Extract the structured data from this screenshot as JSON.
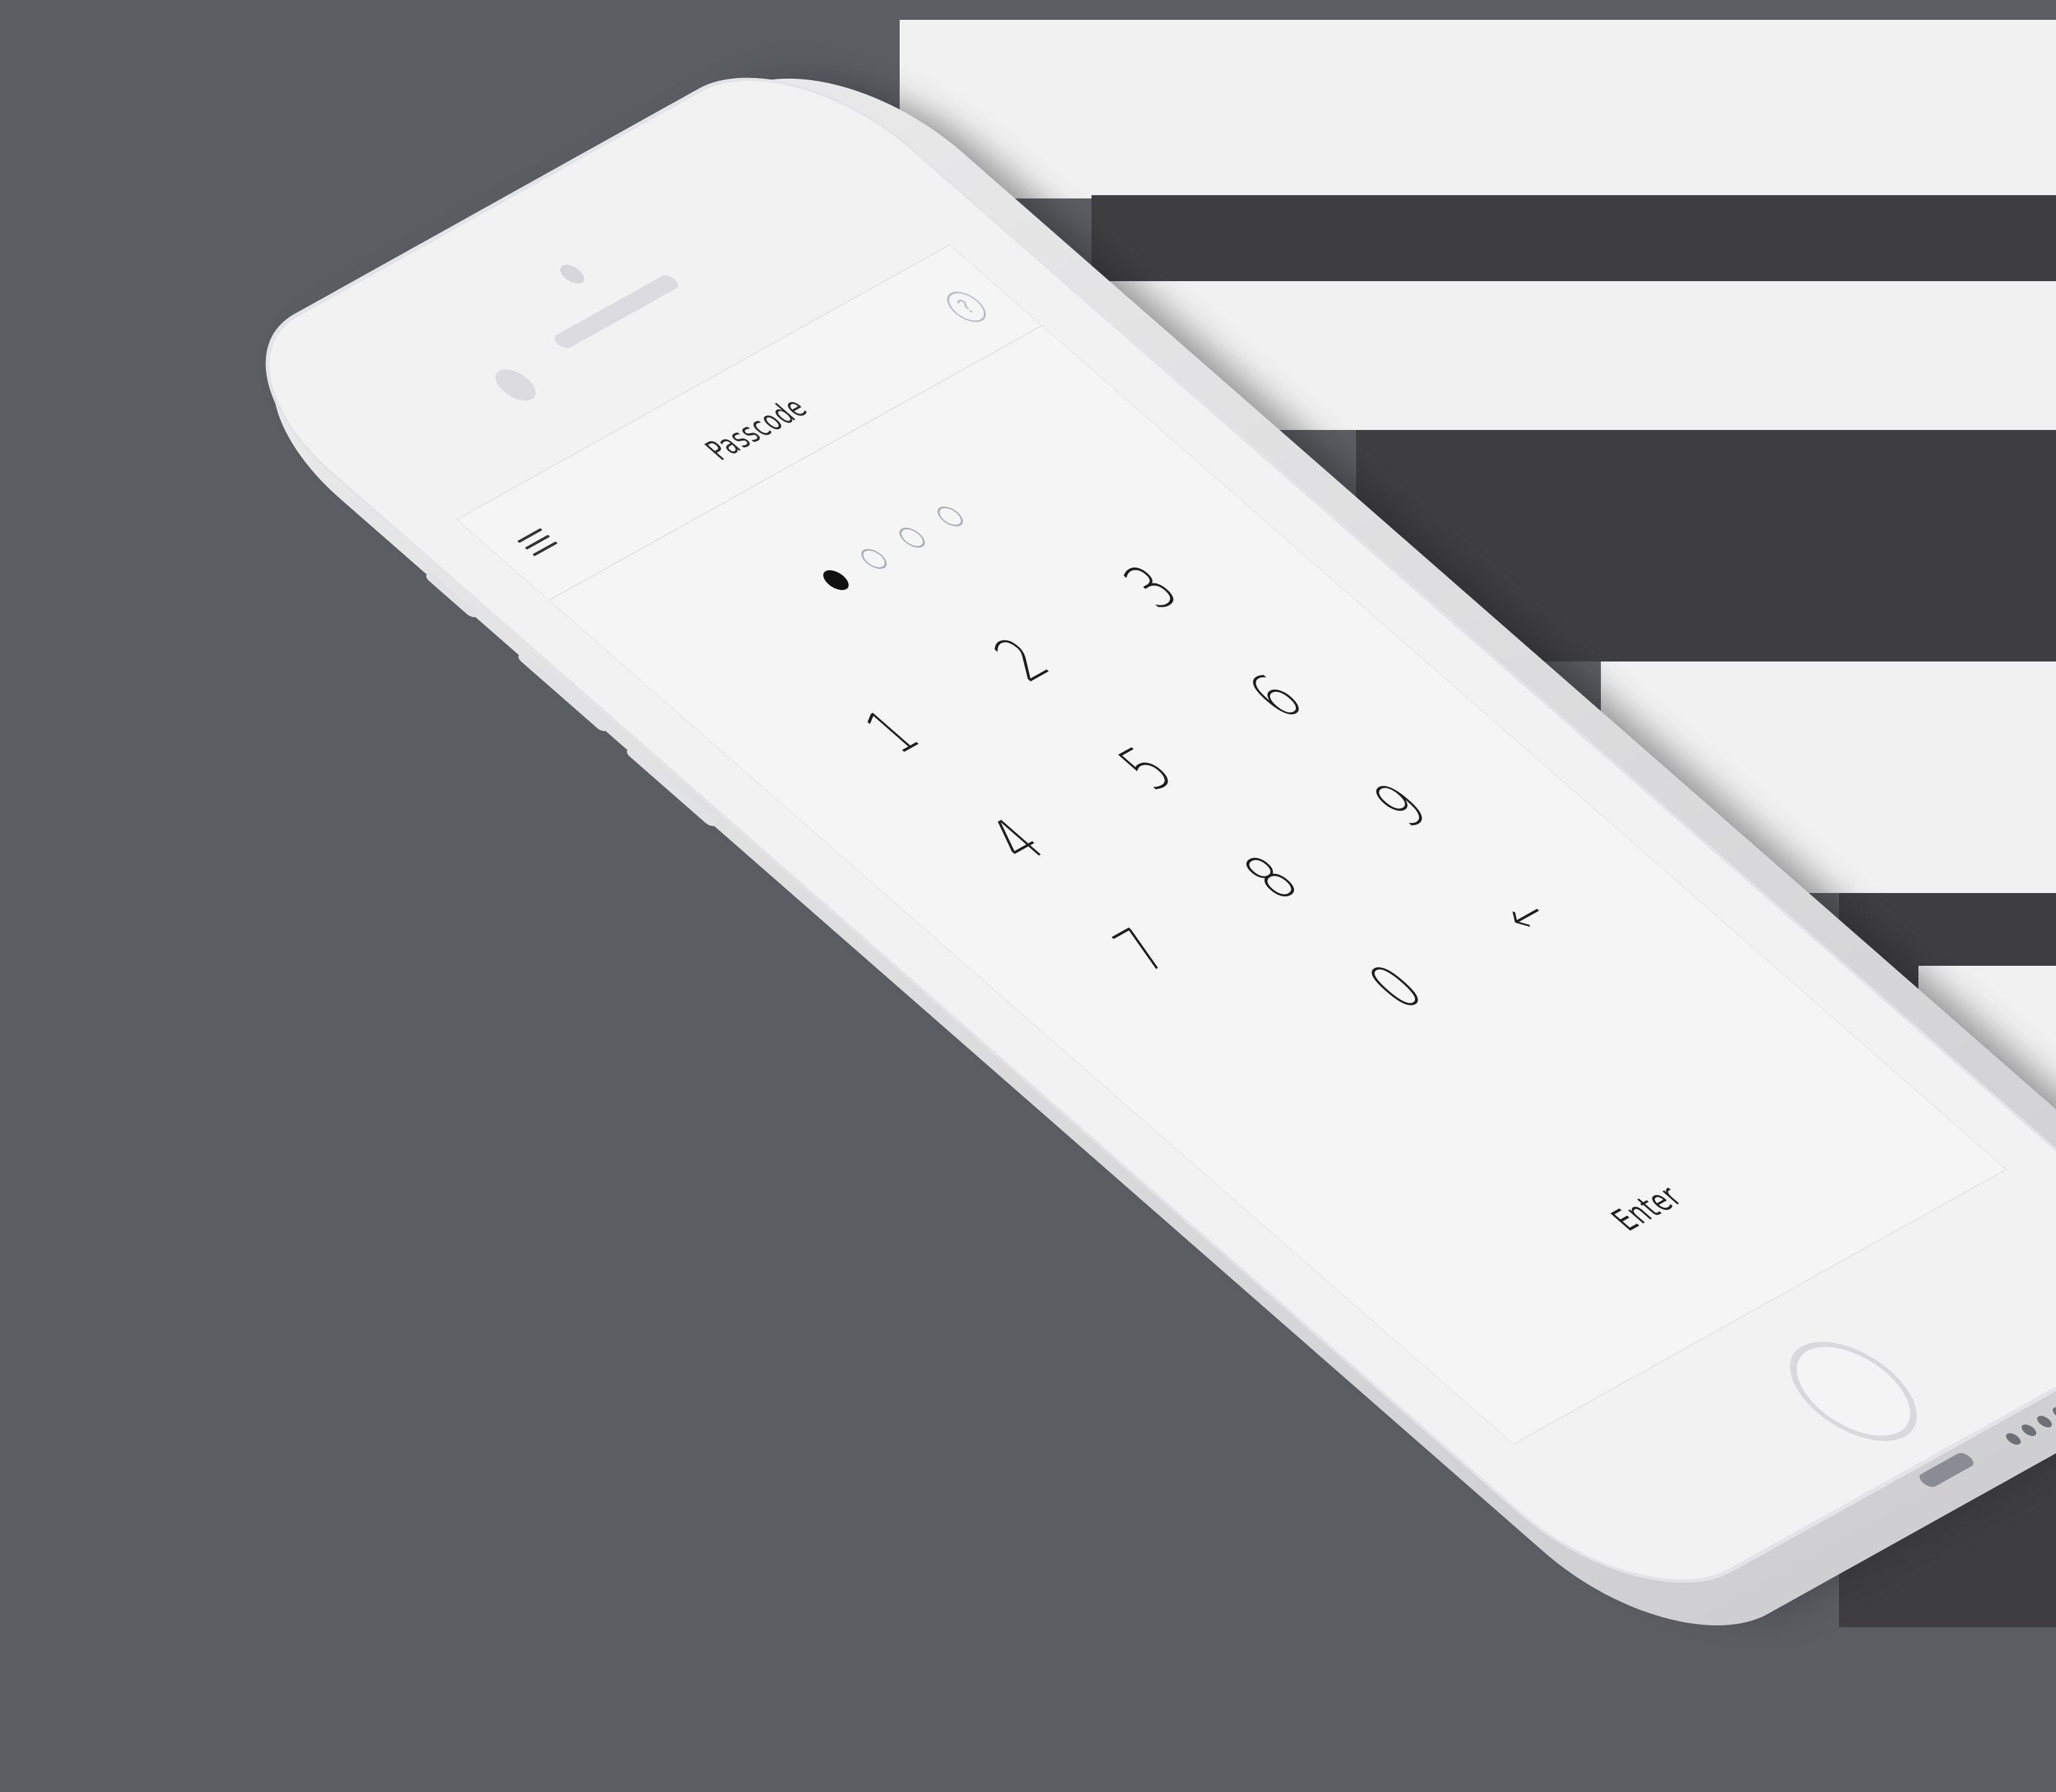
{
  "background": {
    "color": "#5a5d62",
    "panel_color": "#3e3e40"
  },
  "screen": {
    "title": "Passcode",
    "help_icon_glyph": "?",
    "menu_icon": "hamburger-menu-icon",
    "passcode_length": 4,
    "passcode_entered": 1,
    "keypad": [
      "1",
      "2",
      "3",
      "4",
      "5",
      "6",
      "7",
      "8",
      "9",
      "",
      "0",
      "←"
    ],
    "enter_label": "Enter"
  }
}
